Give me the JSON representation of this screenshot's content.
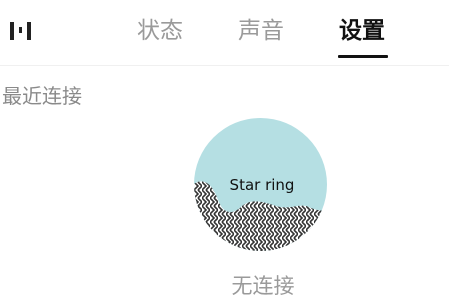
{
  "header": {
    "tabs": [
      {
        "label": "状态",
        "active": false
      },
      {
        "label": "声音",
        "active": false
      },
      {
        "label": "设置",
        "active": true
      }
    ],
    "logo_icon": "app-logo-icon"
  },
  "recent": {
    "section_title": "最近连接",
    "device": {
      "name": "Star ring",
      "status": "无连接",
      "image_icon": "ring-device-icon"
    }
  },
  "colors": {
    "active_tab": "#111111",
    "inactive_tab": "#9a9a9a",
    "ring_fill": "#b5dfe3",
    "pattern": "#333333"
  }
}
